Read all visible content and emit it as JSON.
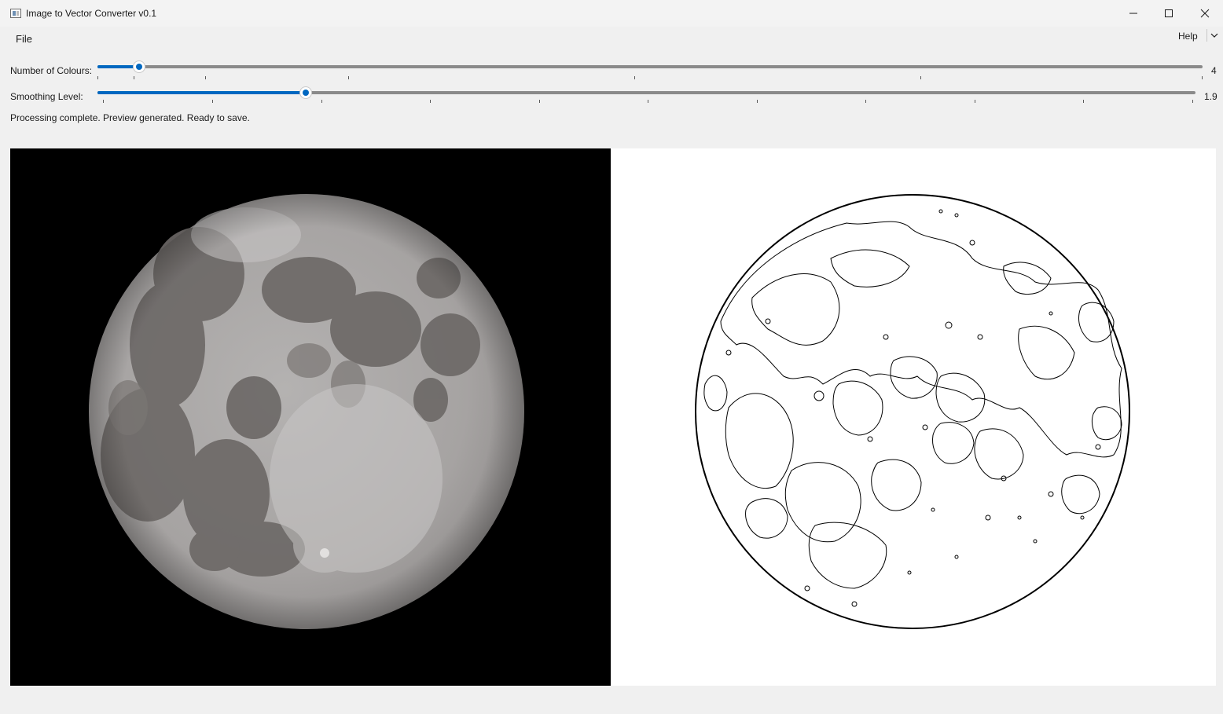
{
  "window": {
    "title": "Image to Vector Converter v0.1",
    "icons": [
      "app-icon",
      "minimize-icon",
      "maximize-icon",
      "close-icon"
    ]
  },
  "menu": {
    "file": "File",
    "help": "Help"
  },
  "controls": {
    "colours": {
      "label": "Number of Colours:",
      "value": "4",
      "fraction": 0.0375
    },
    "smoothing": {
      "label": "Smoothing Level:",
      "value": "1.9",
      "fraction": 0.19
    }
  },
  "status": "Processing complete. Preview generated. Ready to save.",
  "preview": {
    "original_alt": "original-moon-image",
    "vector_alt": "vector-outline-preview"
  },
  "colors": {
    "accent": "#0067c0",
    "background": "#f0f0f0"
  }
}
